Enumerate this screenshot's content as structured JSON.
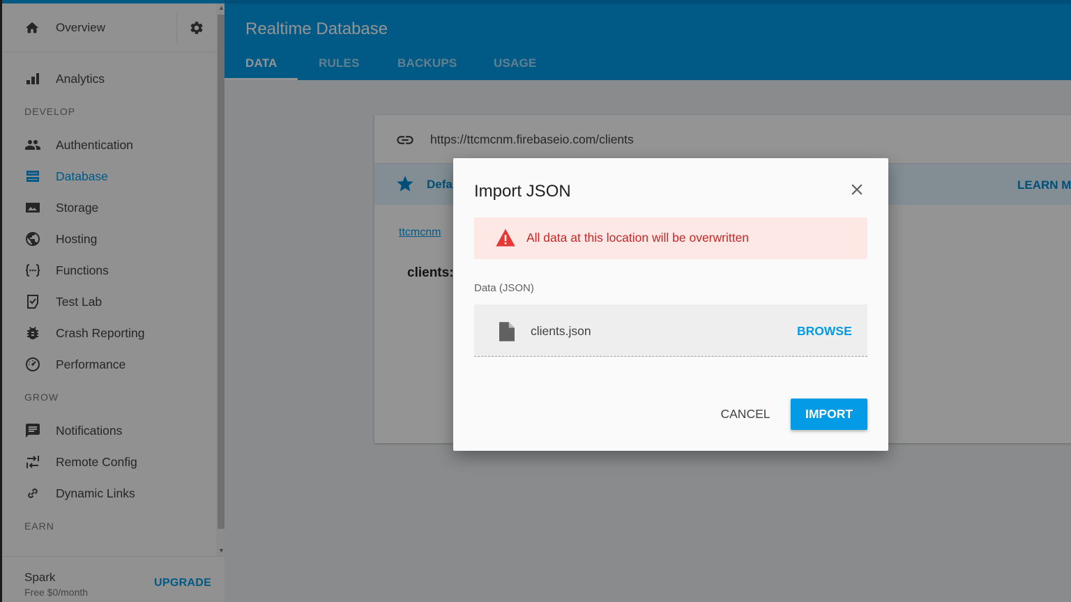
{
  "sidebar": {
    "overview_label": "Overview",
    "items": [
      {
        "label": "Analytics",
        "icon": "bar-chart-icon"
      },
      {
        "label": "Authentication",
        "icon": "people-icon"
      },
      {
        "label": "Database",
        "icon": "database-icon",
        "active": true
      },
      {
        "label": "Storage",
        "icon": "image-icon"
      },
      {
        "label": "Hosting",
        "icon": "globe-icon"
      },
      {
        "label": "Functions",
        "icon": "functions-icon"
      },
      {
        "label": "Test Lab",
        "icon": "test-lab-icon"
      },
      {
        "label": "Crash Reporting",
        "icon": "bug-icon"
      },
      {
        "label": "Performance",
        "icon": "speedometer-icon"
      },
      {
        "label": "Notifications",
        "icon": "message-icon"
      },
      {
        "label": "Remote Config",
        "icon": "remote-config-icon"
      },
      {
        "label": "Dynamic Links",
        "icon": "link-icon"
      }
    ],
    "sections": {
      "develop": "DEVELOP",
      "grow": "GROW",
      "earn": "EARN"
    },
    "plan": {
      "name": "Spark",
      "price": "Free $0/month",
      "upgrade_label": "UPGRADE"
    }
  },
  "header": {
    "title": "Realtime Database",
    "tabs": [
      "DATA",
      "RULES",
      "BACKUPS",
      "USAGE"
    ],
    "active_tab": "DATA"
  },
  "card": {
    "url": "https://ttcmcnm.firebaseio.com/clients",
    "banner_text": "Defa",
    "learn_more": "LEARN MO",
    "breadcrumb": "ttcmcnm",
    "node_key": "clients:"
  },
  "dialog": {
    "title": "Import JSON",
    "warning": "All data at this location will be overwritten",
    "field_label": "Data (JSON)",
    "file_name": "clients.json",
    "browse_label": "BROWSE",
    "cancel_label": "CANCEL",
    "import_label": "IMPORT"
  },
  "colors": {
    "accent": "#039be5",
    "warning_bg": "#fde8e6",
    "warning_text": "#c62828"
  }
}
